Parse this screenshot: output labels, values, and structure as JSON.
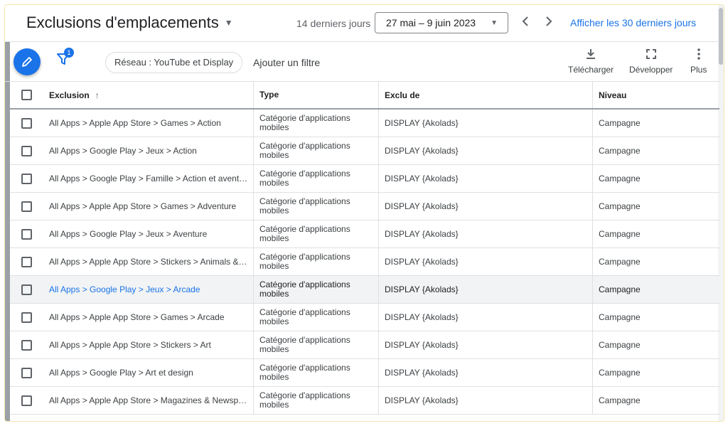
{
  "header": {
    "title": "Exclusions d'emplacements",
    "range_label": "14 derniers jours",
    "date_range": "27 mai – 9 juin 2023",
    "last30_link": "Afficher les 30 derniers jours"
  },
  "toolbar": {
    "filter_count": "1",
    "network_chip": "Réseau : YouTube et Display",
    "add_filter": "Ajouter un filtre",
    "download_label": "Télécharger",
    "expand_label": "Développer",
    "more_label": "Plus"
  },
  "table": {
    "headers": {
      "exclusion": "Exclusion",
      "type": "Type",
      "excluded_from": "Exclu de",
      "level": "Niveau"
    },
    "rows": [
      {
        "exclusion": "All Apps > Apple App Store > Games > Action",
        "type": "Catégorie d'applications mobiles",
        "excluded_from": "DISPLAY {Akolads}",
        "level": "Campagne"
      },
      {
        "exclusion": "All Apps > Google Play > Jeux > Action",
        "type": "Catégorie d'applications mobiles",
        "excluded_from": "DISPLAY {Akolads}",
        "level": "Campagne"
      },
      {
        "exclusion": "All Apps > Google Play > Famille > Action et aventure",
        "type": "Catégorie d'applications mobiles",
        "excluded_from": "DISPLAY {Akolads}",
        "level": "Campagne"
      },
      {
        "exclusion": "All Apps > Apple App Store > Games > Adventure",
        "type": "Catégorie d'applications mobiles",
        "excluded_from": "DISPLAY {Akolads}",
        "level": "Campagne"
      },
      {
        "exclusion": "All Apps > Google Play > Jeux > Aventure",
        "type": "Catégorie d'applications mobiles",
        "excluded_from": "DISPLAY {Akolads}",
        "level": "Campagne"
      },
      {
        "exclusion": "All Apps > Apple App Store > Stickers > Animals & N...",
        "type": "Catégorie d'applications mobiles",
        "excluded_from": "DISPLAY {Akolads}",
        "level": "Campagne"
      },
      {
        "exclusion": "All Apps > Google Play > Jeux > Arcade",
        "type": "Catégorie d'applications mobiles",
        "excluded_from": "DISPLAY {Akolads}",
        "level": "Campagne"
      },
      {
        "exclusion": "All Apps > Apple App Store > Games > Arcade",
        "type": "Catégorie d'applications mobiles",
        "excluded_from": "DISPLAY {Akolads}",
        "level": "Campagne"
      },
      {
        "exclusion": "All Apps > Apple App Store > Stickers > Art",
        "type": "Catégorie d'applications mobiles",
        "excluded_from": "DISPLAY {Akolads}",
        "level": "Campagne"
      },
      {
        "exclusion": "All Apps > Google Play > Art et design",
        "type": "Catégorie d'applications mobiles",
        "excluded_from": "DISPLAY {Akolads}",
        "level": "Campagne"
      },
      {
        "exclusion": "All Apps > Apple App Store > Magazines & Newspap...",
        "type": "Catégorie d'applications mobiles",
        "excluded_from": "DISPLAY {Akolads}",
        "level": "Campagne"
      }
    ]
  },
  "colors": {
    "accent": "#1a73e8",
    "row_highlight": "#f1f3f4"
  }
}
